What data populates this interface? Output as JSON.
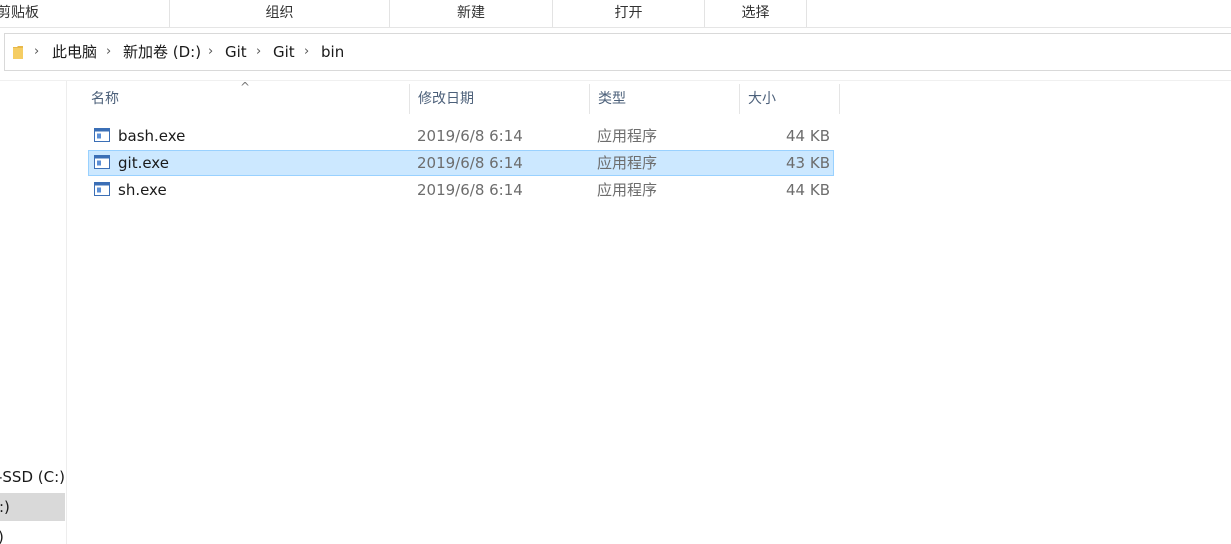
{
  "ribbon": {
    "groups": [
      "剪贴板",
      "组织",
      "新建",
      "打开",
      "选择"
    ]
  },
  "address": {
    "crumbs": [
      "此电脑",
      "新加卷 (D:)",
      "Git",
      "Git",
      "bin"
    ],
    "separator": "›"
  },
  "columns": {
    "name": "名称",
    "modified": "修改日期",
    "type": "类型",
    "size": "大小",
    "sort_indicator": "^"
  },
  "files": [
    {
      "name": "bash.exe",
      "modified": "2019/6/8 6:14",
      "type": "应用程序",
      "size": "44 KB",
      "selected": false
    },
    {
      "name": "git.exe",
      "modified": "2019/6/8 6:14",
      "type": "应用程序",
      "size": "43 KB",
      "selected": true
    },
    {
      "name": "sh.exe",
      "modified": "2019/6/8 6:14",
      "type": "应用程序",
      "size": "44 KB",
      "selected": false
    }
  ],
  "nav": {
    "items": [
      {
        "label": "-SSD (C:)",
        "selected": false
      },
      {
        "label": ":)",
        "selected": true
      },
      {
        "label": ")",
        "selected": false
      }
    ]
  },
  "colors": {
    "selection_bg": "#cce8ff",
    "selection_border": "#99d1ff",
    "nav_selected": "#d9d9d9",
    "header_text": "#4c607a"
  }
}
